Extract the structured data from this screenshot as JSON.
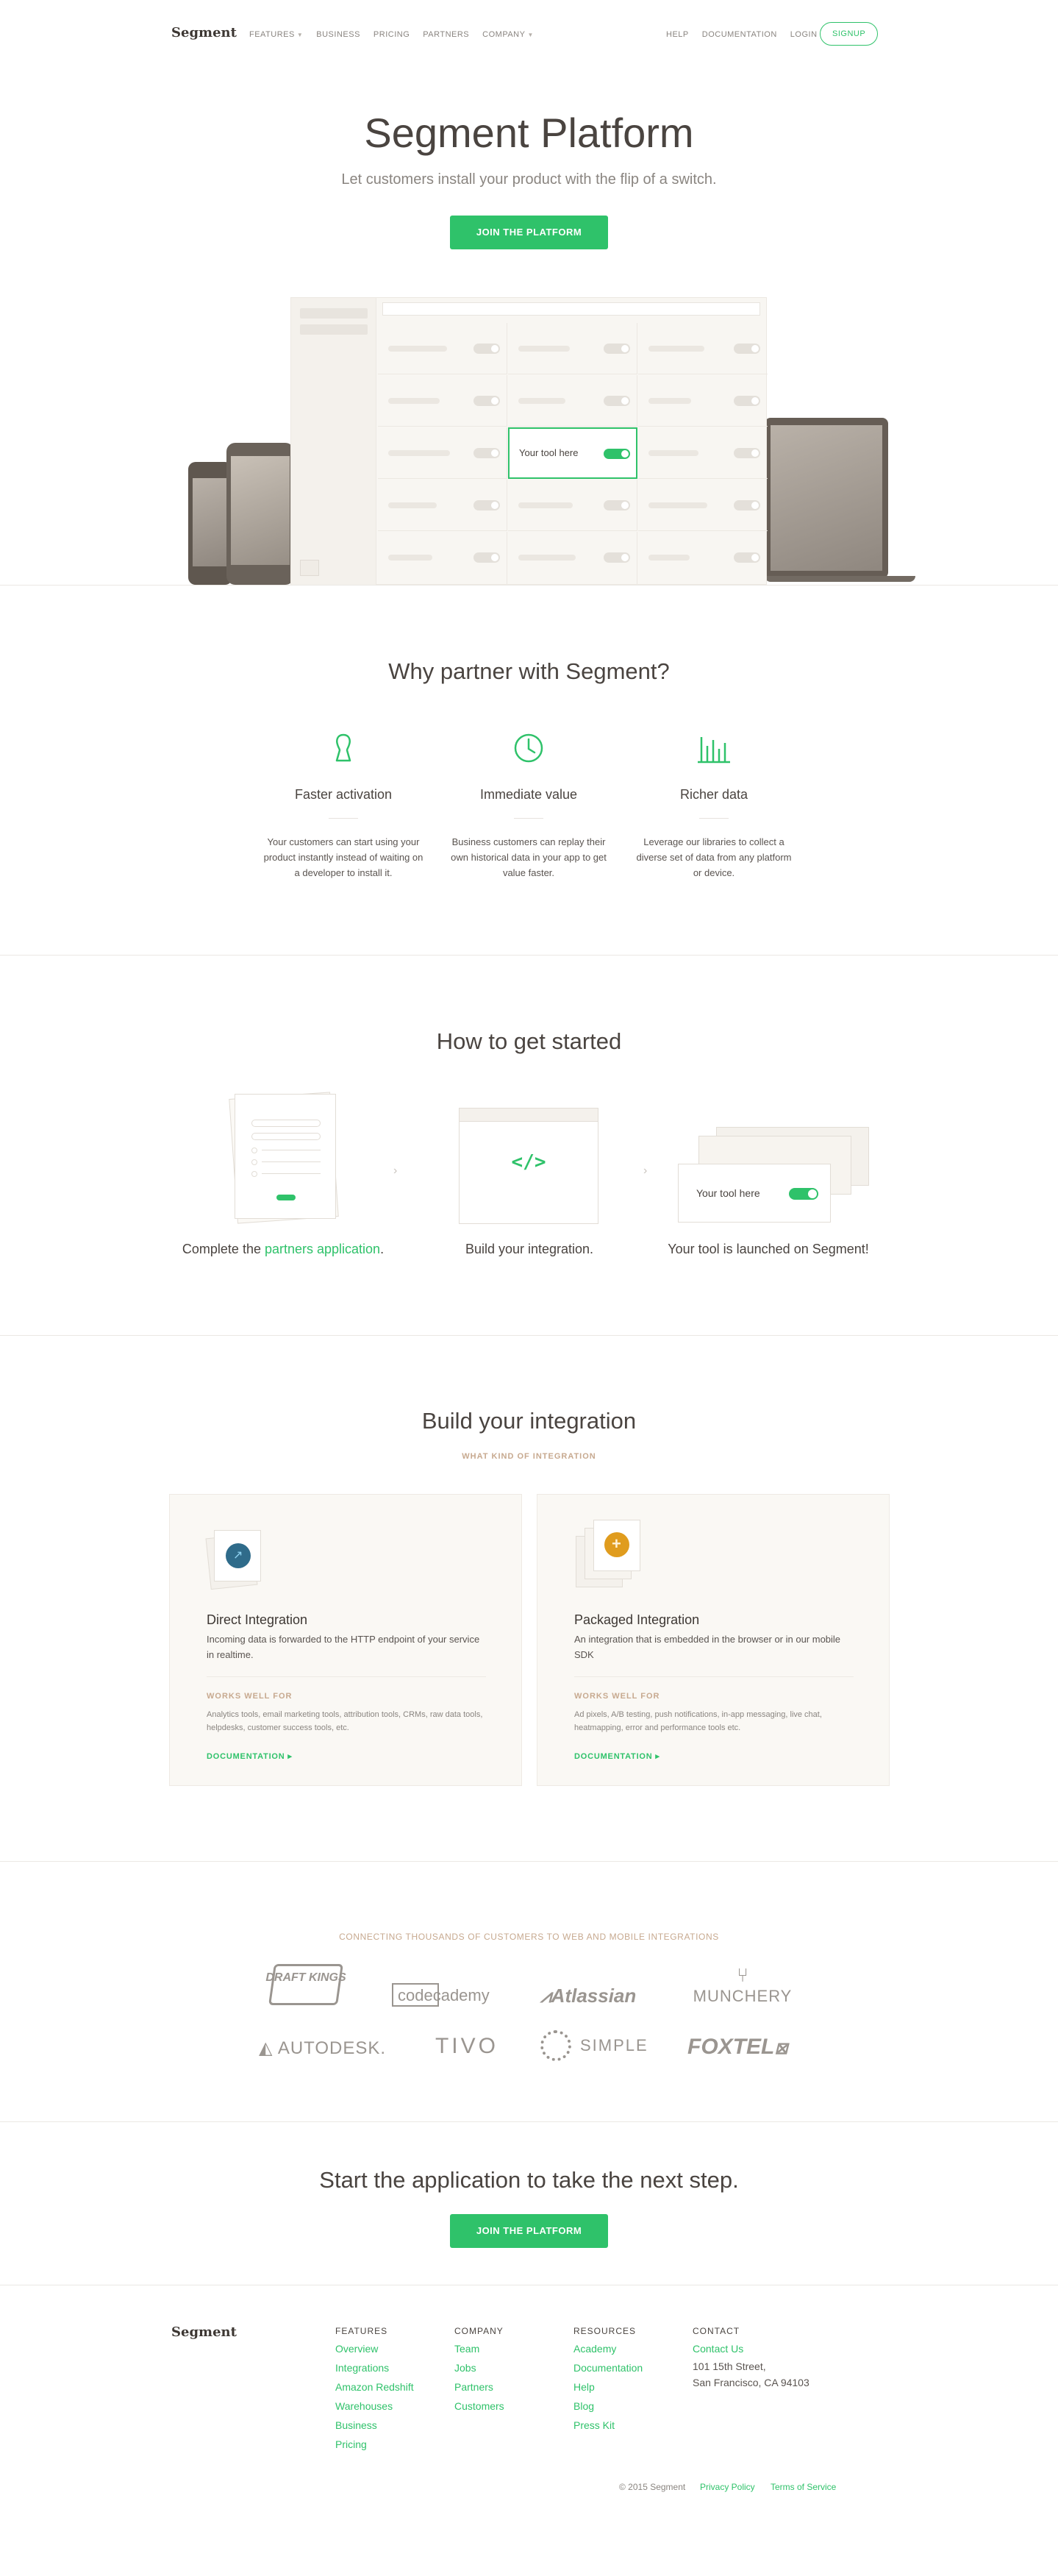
{
  "nav": {
    "logo": "Segment",
    "left": [
      "FEATURES",
      "BUSINESS",
      "PRICING",
      "PARTNERS",
      "COMPANY"
    ],
    "right": [
      "HELP",
      "DOCUMENTATION",
      "LOGIN"
    ],
    "signup": "SIGNUP"
  },
  "hero": {
    "title": "Segment Platform",
    "subtitle": "Let customers install your product with the flip of a switch.",
    "cta": "JOIN THE PLATFORM",
    "your_tool": "Your tool here"
  },
  "why": {
    "title": "Why partner with Segment?",
    "items": [
      {
        "icon": "person-icon",
        "title": "Faster activation",
        "text": "Your customers can start using your product instantly instead of waiting on a developer to install it."
      },
      {
        "icon": "clock-icon",
        "title": "Immediate value",
        "text": "Business customers can replay their own historical data in your app to get value faster."
      },
      {
        "icon": "bar-chart-icon",
        "title": "Richer data",
        "text": "Leverage our libraries to collect a diverse set of data from any platform or device."
      }
    ]
  },
  "how": {
    "title": "How to get started",
    "step1_prefix": "Complete the ",
    "step1_link": "partners application",
    "step1_suffix": ".",
    "step2": "Build your integration.",
    "step3": "Your tool is launched on Segment!",
    "code_glyph": "</>",
    "your_tool": "Your tool here"
  },
  "build": {
    "title": "Build your integration",
    "subtitle": "WHAT KIND OF INTEGRATION",
    "cards": [
      {
        "title": "Direct Integration",
        "desc": "Incoming data is forwarded to the HTTP endpoint of your service in realtime.",
        "works": "WORKS WELL FOR",
        "works_text": "Analytics tools, email marketing tools, attribution tools, CRMs, raw data tools, helpdesks, customer success tools, etc.",
        "doc": "DOCUMENTATION"
      },
      {
        "title": "Packaged Integration",
        "desc": "An integration that is embedded in the browser or in our mobile SDK",
        "works": "WORKS WELL FOR",
        "works_text": "Ad pixels, A/B testing, push notifications, in-app messaging, live chat, heatmapping, error and performance tools etc.",
        "doc": "DOCUMENTATION"
      }
    ]
  },
  "customers": {
    "title": "CONNECTING THOUSANDS OF CUSTOMERS TO WEB AND MOBILE INTEGRATIONS",
    "logos": [
      "DRAFT KINGS",
      "codecademy",
      "Atlassian",
      "MUNCHERY",
      "AUTODESK.",
      "TIVO",
      "SIMPLE",
      "FOXTEL"
    ]
  },
  "cta2": {
    "title": "Start the application to take the next step.",
    "button": "JOIN THE PLATFORM"
  },
  "footer": {
    "logo": "Segment",
    "features_head": "FEATURES",
    "features": [
      "Overview",
      "Integrations",
      "Amazon Redshift",
      "Warehouses",
      "Business",
      "Pricing"
    ],
    "company_head": "COMPANY",
    "company": [
      "Team",
      "Jobs",
      "Partners",
      "Customers"
    ],
    "resources_head": "RESOURCES",
    "resources": [
      "Academy",
      "Documentation",
      "Help",
      "Blog",
      "Press Kit"
    ],
    "contact_head": "CONTACT",
    "contact_link": "Contact Us",
    "address1": "101 15th Street,",
    "address2": "San Francisco, CA 94103",
    "copyright": "© 2015 Segment",
    "privacy": "Privacy Policy",
    "terms": "Terms of Service"
  }
}
